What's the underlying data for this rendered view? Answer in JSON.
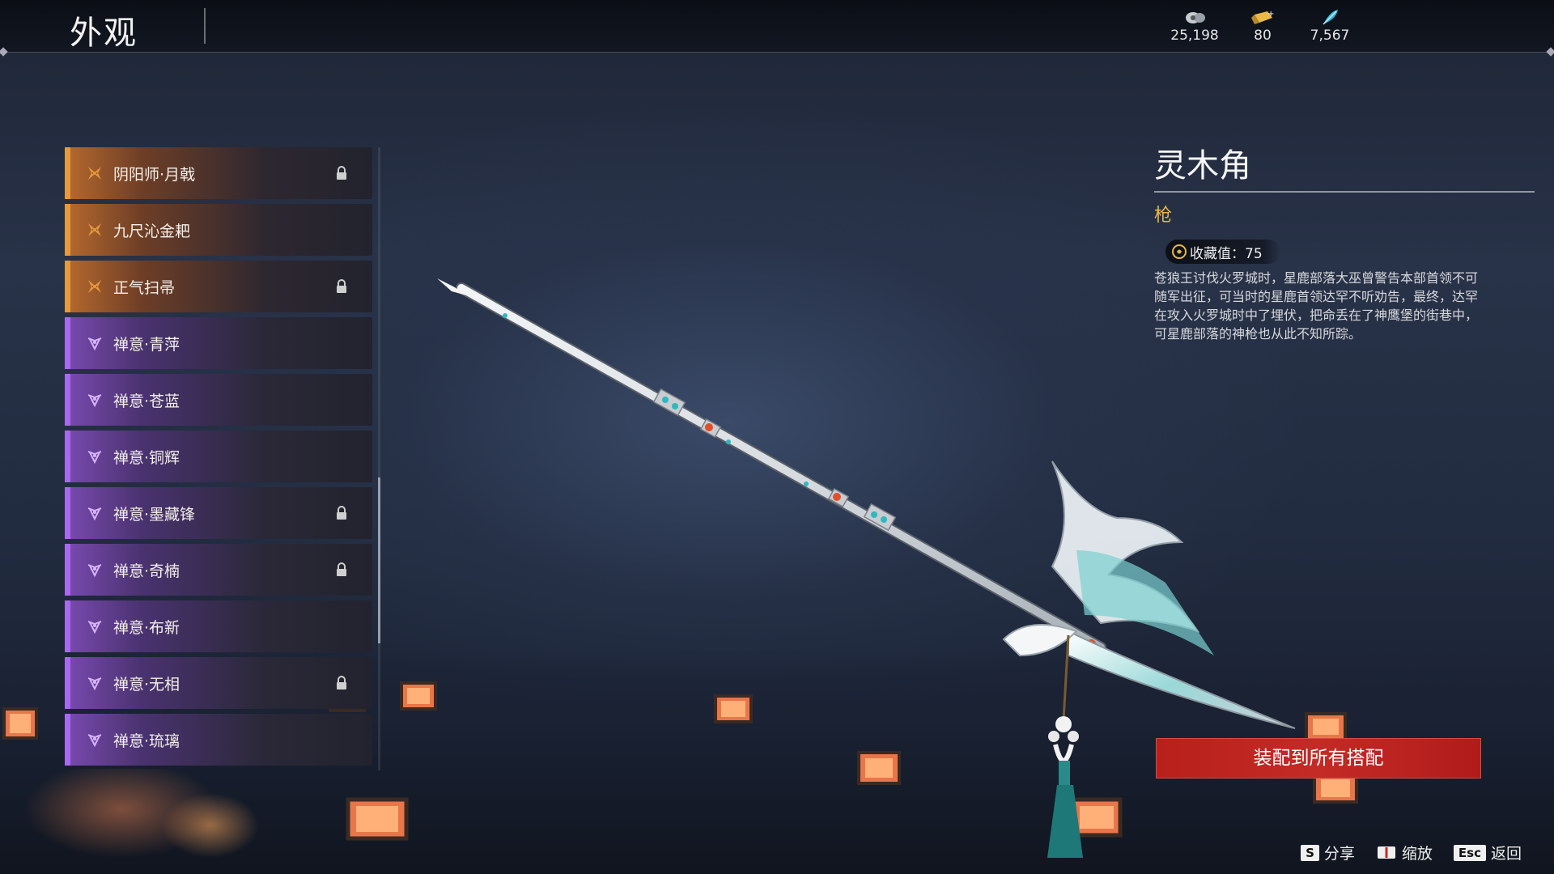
{
  "header": {
    "title": "外观"
  },
  "currencies": [
    {
      "icon": "coin-stack-icon",
      "value": "25,198"
    },
    {
      "icon": "gold-ingot-icon",
      "value": "80"
    },
    {
      "icon": "feather-icon",
      "value": "7,567"
    }
  ],
  "list": {
    "items": [
      {
        "label": "阴阳师·月戟",
        "rarity": "gold",
        "locked": true
      },
      {
        "label": "九尺沁金耙",
        "rarity": "gold",
        "locked": false
      },
      {
        "label": "正气扫帚",
        "rarity": "gold",
        "locked": true
      },
      {
        "label": "禅意·青萍",
        "rarity": "purple",
        "locked": false
      },
      {
        "label": "禅意·苍蓝",
        "rarity": "purple",
        "locked": false
      },
      {
        "label": "禅意·铜辉",
        "rarity": "purple",
        "locked": false
      },
      {
        "label": "禅意·墨藏锋",
        "rarity": "purple",
        "locked": true
      },
      {
        "label": "禅意·奇楠",
        "rarity": "purple",
        "locked": true
      },
      {
        "label": "禅意·布新",
        "rarity": "purple",
        "locked": false
      },
      {
        "label": "禅意·无相",
        "rarity": "purple",
        "locked": true
      },
      {
        "label": "禅意·琉璃",
        "rarity": "purple",
        "locked": false
      }
    ]
  },
  "detail": {
    "name": "灵木角",
    "type": "枪",
    "collection_label": "收藏值：75",
    "description": "苍狼王讨伐火罗城时，星鹿部落大巫曾警告本部首领不可随军出征，可当时的星鹿首领达罕不听劝告，最终，达罕在攻入火罗城时中了埋伏，把命丢在了神鹰堡的街巷中，可星鹿部落的神枪也从此不知所踪。"
  },
  "equip_button": "装配到所有搭配",
  "hints": [
    {
      "key": "S",
      "label": "分享"
    },
    {
      "key": "book-icon",
      "label": "缩放"
    },
    {
      "key": "Esc",
      "label": "返回"
    }
  ],
  "colors": {
    "gold": "#e59a3c",
    "purple": "#a868f0",
    "accent_red": "#c42a26",
    "type_gold": "#e8b54c"
  }
}
